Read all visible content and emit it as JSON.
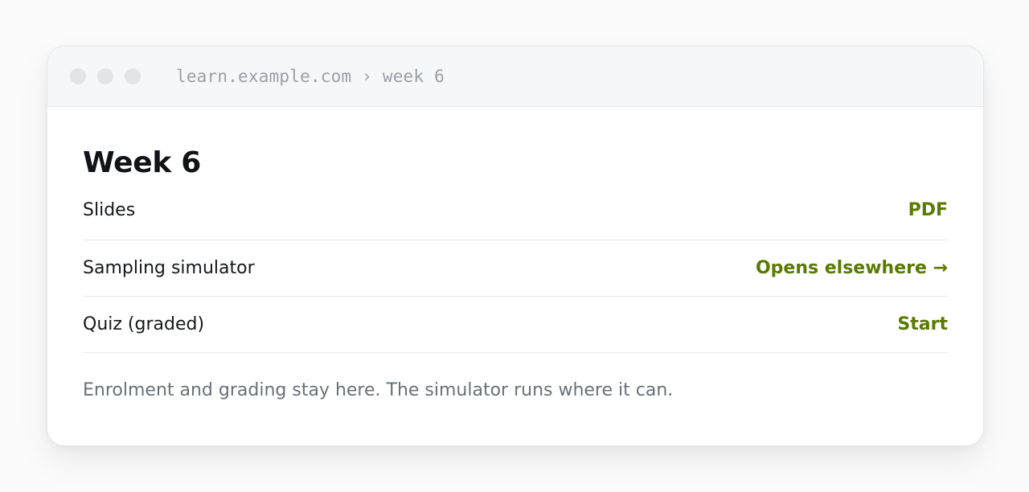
{
  "window": {
    "address": "learn.example.com › week 6"
  },
  "page": {
    "title": "Week 6",
    "items": [
      {
        "label": "Slides",
        "action": "PDF"
      },
      {
        "label": "Sampling simulator",
        "action": "Opens elsewhere →"
      },
      {
        "label": "Quiz (graded)",
        "action": "Start"
      }
    ],
    "note": "Enrolment and grading stay here. The simulator runs where it can."
  },
  "colors": {
    "accent": "#5a7a00",
    "muted_text": "#6b7078",
    "address_text": "#9a9ea6"
  }
}
